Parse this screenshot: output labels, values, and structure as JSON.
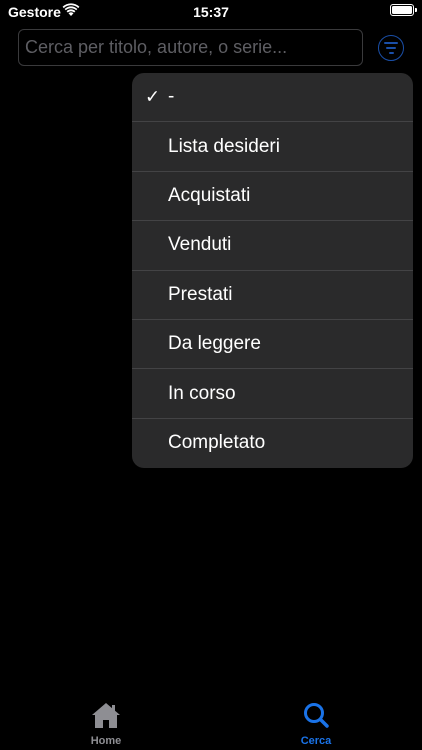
{
  "status_bar": {
    "carrier": "Gestore",
    "time": "15:37"
  },
  "search": {
    "placeholder": "Cerca per titolo, autore, o serie...",
    "value": ""
  },
  "menu": {
    "items": [
      {
        "label": "-",
        "checked": true
      },
      {
        "label": "Lista desideri",
        "checked": false
      },
      {
        "label": "Acquistati",
        "checked": false
      },
      {
        "label": "Venduti",
        "checked": false
      },
      {
        "label": "Prestati",
        "checked": false
      },
      {
        "label": "Da leggere",
        "checked": false
      },
      {
        "label": "In corso",
        "checked": false
      },
      {
        "label": "Completato",
        "checked": false
      }
    ],
    "check_glyph": "✓"
  },
  "tab_bar": {
    "tabs": [
      {
        "label": "Home",
        "icon": "house-icon",
        "active": false
      },
      {
        "label": "Cerca",
        "icon": "magnifying-glass-icon",
        "active": true
      }
    ]
  },
  "colors": {
    "accent": "#1a73e8",
    "menu_background": "#2a2a2b",
    "inactive_tab": "#8e8e93"
  }
}
